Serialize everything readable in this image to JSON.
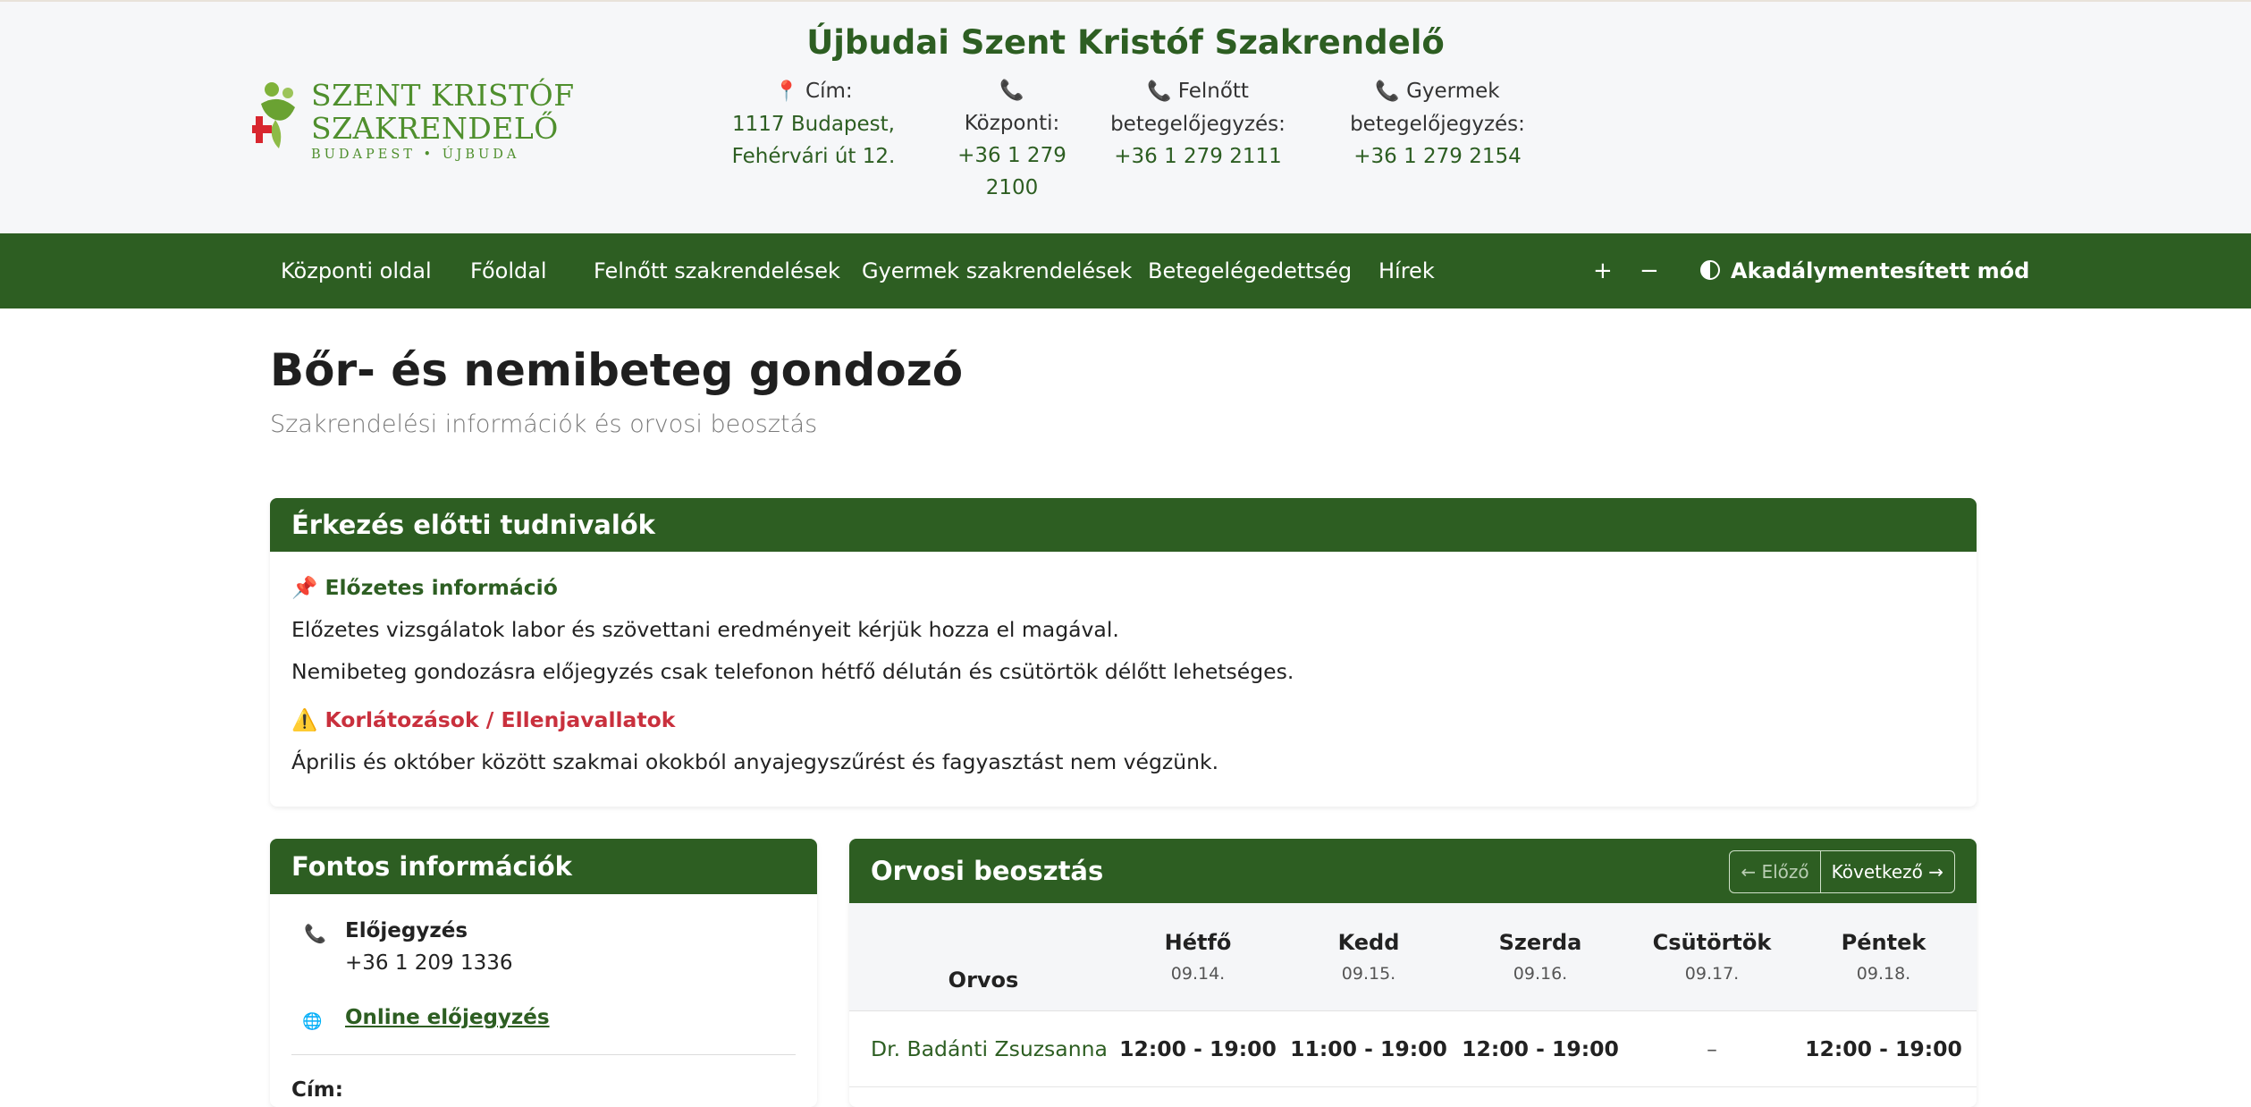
{
  "logo": {
    "line1": "SZENT KRISTÓF",
    "line2": "SZAKRENDELŐ",
    "line3": "BUDAPEST • ÚJBUDA"
  },
  "header": {
    "title": "Újbudai Szent Kristóf Szakrendelő",
    "address": {
      "label": "Cím:",
      "line1": "1117 Budapest,",
      "line2": "Fehérvári út 12."
    },
    "central": {
      "label": "Központi:",
      "line1": "+36 1 279",
      "line2": "2100"
    },
    "adult": {
      "label1": "Felnőtt",
      "label2": "betegelőjegyzés:",
      "phone": "+36 1 279 2111"
    },
    "child": {
      "label1": "Gyermek",
      "label2": "betegelőjegyzés:",
      "phone": "+36 1 279 2154"
    }
  },
  "nav": {
    "items": [
      "Központi oldal",
      "Főoldal",
      "Felnőtt szakrendelések",
      "Gyermek szakrendelések",
      "Betegelégedettség",
      "Hírek"
    ],
    "font_increase": "+",
    "font_decrease": "−",
    "accessibility": "Akadálymentesített mód"
  },
  "page": {
    "title": "Bőr- és nemibeteg gondozó",
    "subtitle": "Szakrendelési információk és orvosi beosztás"
  },
  "notice": {
    "title": "Érkezés előtti tudnivalók",
    "prior_heading": "Előzetes információ",
    "prior_lines": [
      "Előzetes vizsgálatok labor és szövettani eredményeit kérjük hozza el magával.",
      "Nemibeteg gondozásra előjegyzés csak telefonon hétfő délután és csütörtök délőtt lehetséges."
    ],
    "restrict_heading": "Korlátozások / Ellenjavallatok",
    "restrict_line": "Április és október között szakmai okokból anyajegyszűrést és fagyasztást nem végzünk."
  },
  "info": {
    "title": "Fontos információk",
    "booking_label": "Előjegyzés",
    "booking_phone": "+36 1 209 1336",
    "online_link": "Online előjegyzés",
    "address_label": "Cím:"
  },
  "schedule": {
    "title": "Orvosi beosztás",
    "prev": "← Előző",
    "next": "Következő →",
    "doctor_header": "Orvos",
    "days": [
      {
        "name": "Hétfő",
        "date": "09.14."
      },
      {
        "name": "Kedd",
        "date": "09.15."
      },
      {
        "name": "Szerda",
        "date": "09.16."
      },
      {
        "name": "Csütörtök",
        "date": "09.17."
      },
      {
        "name": "Péntek",
        "date": "09.18."
      }
    ],
    "rows": [
      {
        "doctor": "Dr. Badánti Zsuzsanna",
        "hours": [
          "12:00 - 19:00",
          "11:00 - 19:00",
          "12:00 - 19:00",
          "–",
          "12:00 - 19:00"
        ]
      }
    ]
  },
  "colors": {
    "brand_green": "#2d5e22",
    "logo_green": "#4f8f2d",
    "icon_pink": "#c44579",
    "warning_red": "#c9303d"
  }
}
